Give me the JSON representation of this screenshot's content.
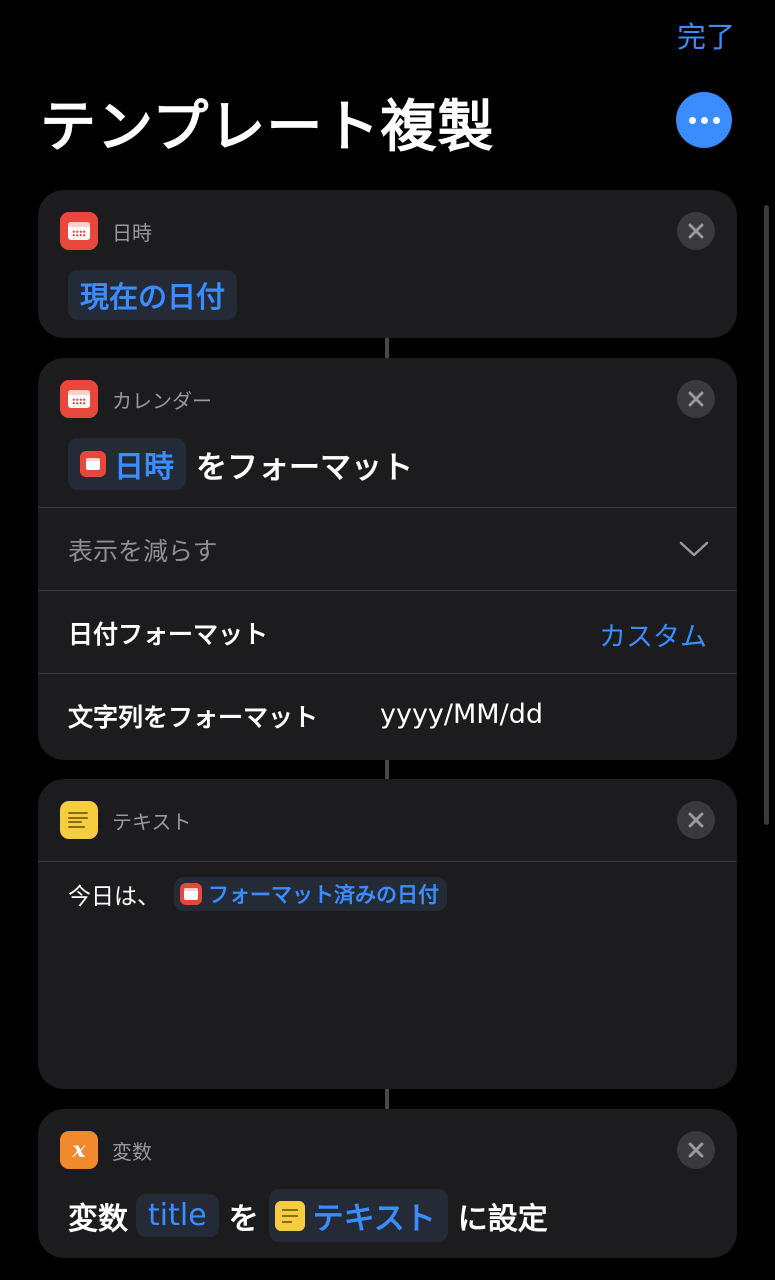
{
  "header": {
    "done_label": "完了",
    "title": "テンプレート複製",
    "more_icon": "ellipsis-icon"
  },
  "colors": {
    "accent": "#3b8cff",
    "background": "#000000",
    "card": "#1c1c1e",
    "calendar_icon": "#e8473c",
    "text_icon": "#f6cd3f",
    "variable_icon": "#f08a2c"
  },
  "actions": [
    {
      "app_name": "日時",
      "icon": "calendar-icon",
      "token": "現在の日付"
    },
    {
      "app_name": "カレンダー",
      "icon": "calendar-icon",
      "token": "日時",
      "verb": "をフォーマット",
      "show_less": "表示を減らす",
      "date_format_label": "日付フォーマット",
      "date_format_value": "カスタム",
      "format_string_label": "文字列をフォーマット",
      "format_string_value": "yyyy/MM/dd"
    },
    {
      "app_name": "テキスト",
      "icon": "text-icon",
      "prefix": "今日は、",
      "token": "フォーマット済みの日付"
    },
    {
      "app_name": "変数",
      "icon": "variable-icon",
      "lead": "変数",
      "variable_name": "title",
      "particle": "を",
      "token": "テキスト",
      "suffix": "に設定"
    }
  ]
}
